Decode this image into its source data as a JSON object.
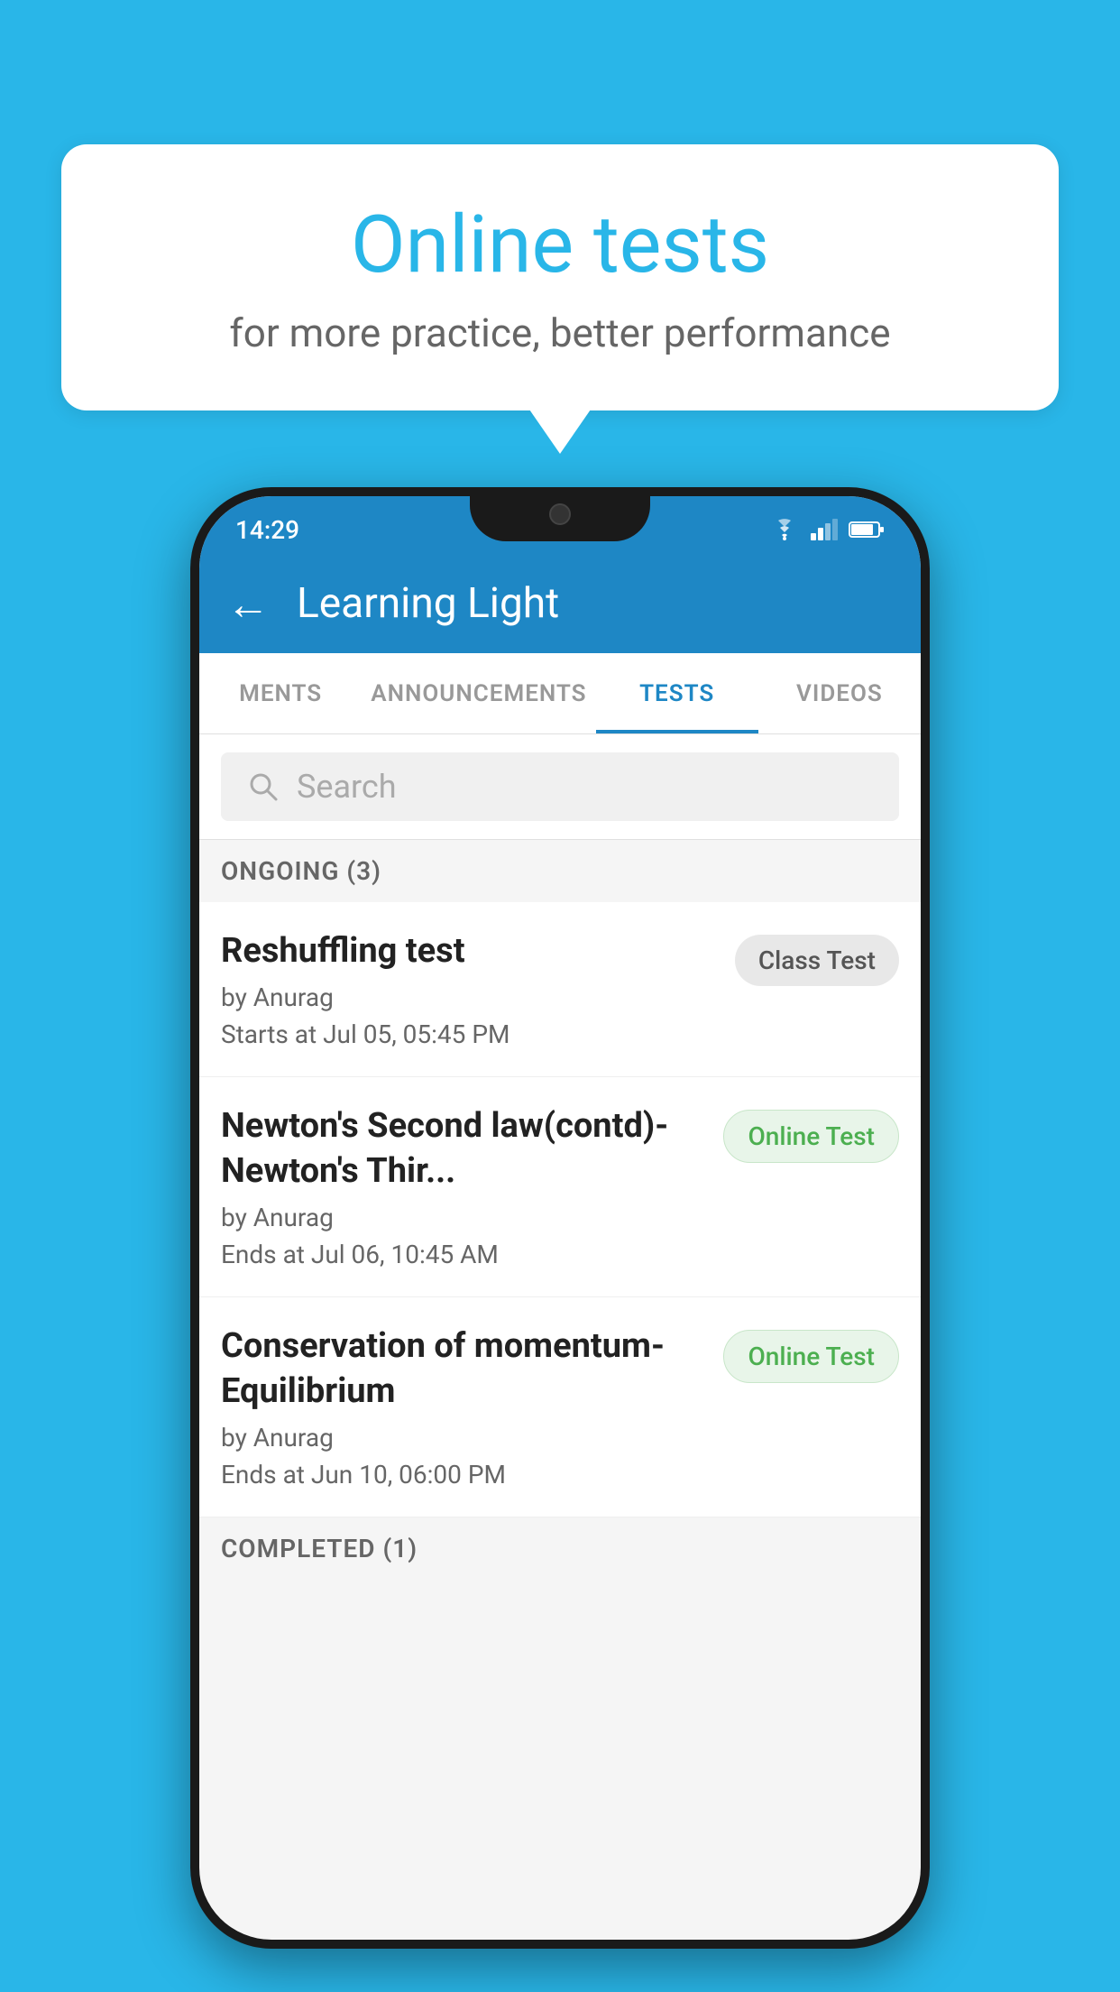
{
  "background": {
    "color": "#29b6e8"
  },
  "speech_bubble": {
    "title": "Online tests",
    "subtitle": "for more practice, better performance"
  },
  "status_bar": {
    "time": "14:29",
    "wifi": "wifi",
    "signal": "signal",
    "battery": "battery"
  },
  "app_header": {
    "back_label": "←",
    "title": "Learning Light"
  },
  "tabs": [
    {
      "label": "MENTS",
      "active": false
    },
    {
      "label": "ANNOUNCEMENTS",
      "active": false
    },
    {
      "label": "TESTS",
      "active": true
    },
    {
      "label": "VIDEOS",
      "active": false
    }
  ],
  "search": {
    "placeholder": "Search"
  },
  "ongoing_section": {
    "label": "ONGOING (3)"
  },
  "tests": [
    {
      "name": "Reshuffling test",
      "author": "by Anurag",
      "time_label": "Starts at",
      "time": "Jul 05, 05:45 PM",
      "badge": "Class Test",
      "badge_type": "class"
    },
    {
      "name": "Newton's Second law(contd)-Newton's Thir...",
      "author": "by Anurag",
      "time_label": "Ends at",
      "time": "Jul 06, 10:45 AM",
      "badge": "Online Test",
      "badge_type": "online"
    },
    {
      "name": "Conservation of momentum-Equilibrium",
      "author": "by Anurag",
      "time_label": "Ends at",
      "time": "Jun 10, 06:00 PM",
      "badge": "Online Test",
      "badge_type": "online"
    }
  ],
  "completed_section": {
    "label": "COMPLETED (1)"
  }
}
